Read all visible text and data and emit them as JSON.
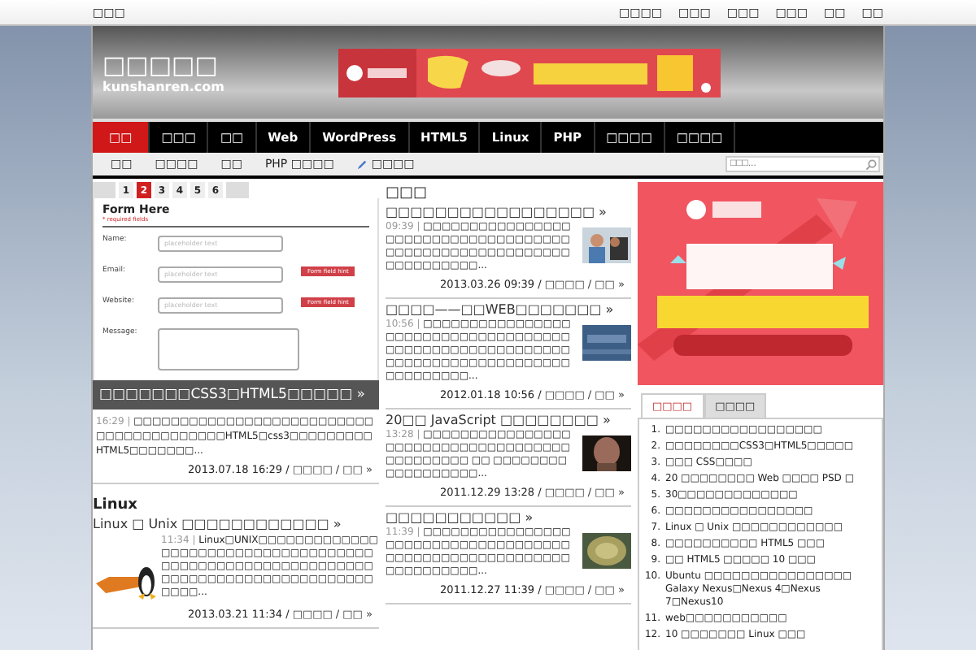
{
  "topbar": {
    "left": "□□□",
    "links": [
      "□□□□",
      "□□□",
      "□□□",
      "□□□",
      "□□",
      "□□"
    ]
  },
  "header": {
    "logo": "□□□□□",
    "domain": "kunshanren.com"
  },
  "nav": [
    {
      "label": "□□",
      "selected": true
    },
    {
      "label": "□□□",
      "selected": false
    },
    {
      "label": "□□",
      "selected": false
    },
    {
      "label": "Web",
      "selected": false
    },
    {
      "label": "WordPress",
      "selected": false
    },
    {
      "label": "HTML5",
      "selected": false
    },
    {
      "label": "Linux",
      "selected": false
    },
    {
      "label": "PHP",
      "selected": false
    },
    {
      "label": "□□□□",
      "selected": false
    },
    {
      "label": "□□□□",
      "selected": false
    }
  ],
  "subnav": [
    {
      "label": "□□",
      "kind": "text"
    },
    {
      "label": "□□□□",
      "kind": "text"
    },
    {
      "label": "□□",
      "kind": "text"
    },
    {
      "label": "PHP □□□□",
      "kind": "text"
    },
    {
      "label": "□□□□",
      "kind": "pen"
    }
  ],
  "search": {
    "placeholder": "□□□..."
  },
  "slider": {
    "pages": [
      {
        "label": "1",
        "selected": false
      },
      {
        "label": "2",
        "selected": true
      },
      {
        "label": "3",
        "selected": false
      },
      {
        "label": "4",
        "selected": false
      },
      {
        "label": "5",
        "selected": false
      },
      {
        "label": "6",
        "selected": false
      }
    ],
    "form": {
      "title": "Form Here",
      "note": "* required fields",
      "fields": [
        {
          "label": "Name:",
          "placeholder": "placeholder text",
          "kind": "input"
        },
        {
          "label": "Email:",
          "placeholder": "placeholder text",
          "kind": "input",
          "hint": "Form field hint"
        },
        {
          "label": "Website:",
          "placeholder": "placeholder text",
          "kind": "input",
          "hint": "Form field hint"
        },
        {
          "label": "Message:",
          "kind": "textarea"
        }
      ]
    },
    "caption": "□□□□□□□CSS3□HTML5□□□□□ »"
  },
  "featured": {
    "time": "16:29 |",
    "excerpt": "□□□□□□□□□□□□□□□□□□□□□□□□□□□□□□□□□□□□□□□□HTML5□css3□□□□□□□□□HTML5□□□□□□□...",
    "date": "2013.07.18 16:29 /",
    "category": "□□□□",
    "comments": "/ □□ »"
  },
  "linux": {
    "heading": "Linux",
    "title": "Linux □ Unix □□□□□□□□□□□□ »",
    "time": "11:34 |",
    "excerpt": "Linux□UNIX□□□□□□□□□□□□□□□□□□□□□□□□□□□□□□□□□□□□□□□□□□□□□□□□□□□□□□□□□□□□□□□□□□□□□□□□□□□□□□□□□□□□□□...",
    "date": "2013.03.21 11:34 /",
    "category": "□□□□",
    "comments": "/ □□ »"
  },
  "middle": {
    "heading": "□□□",
    "posts": [
      {
        "title": "□□□□□□□□□□□□□□□□□ »",
        "time": "09:39 |",
        "excerpt": "□□□□□□□□□□□□□□□□□□□□□□□□□□□□□□□□□□□□□□□□□□□□□□□□□□□□□□□□□□□□□□□□□□...",
        "date": "2013.03.26 09:39 /",
        "category": "□□□□",
        "comments": "/ □□ »"
      },
      {
        "title": "□□□□——□□WEB□□□□□□□ »",
        "time": "10:56 |",
        "excerpt": "□□□□□□□□□□□□□□□□□□□□□□□□□□□□□□□□□□□□□□□□□□□□□□□□□□□□□□□□□□□□□□□□□□□□□□□□□□□□□□□□□□□□□...",
        "date": "2012.01.18 10:56 /",
        "category": "□□□□",
        "comments": "/ □□ »"
      },
      {
        "title": "20□□ JavaScript □□□□□□□□ »",
        "time": "13:28 |",
        "excerpt": "□□□□□□□□□□□□□□□□□□□□□□□□□□□□□□□□□□□□□□□□□□□□□ □□ □□□□□□□□□□□□□□□□□□...",
        "date": "2011.12.29 13:28 /",
        "category": "□□□□",
        "comments": "/ □□ »"
      },
      {
        "title": "□□□□□□□□□□□ »",
        "time": "11:39 |",
        "excerpt": "□□□□□□□□□□□□□□□□□□□□□□□□□□□□□□□□□□□□□□□□□□□□□□□□□□□□□□□□□□□□□□□□□□...",
        "date": "2011.12.27 11:39 /",
        "category": "□□□□",
        "comments": "/ □□ »"
      }
    ]
  },
  "sidebar": {
    "tabs": [
      {
        "label": "□□□□",
        "selected": true
      },
      {
        "label": "□□□□",
        "selected": false
      }
    ],
    "list": [
      {
        "num": "1.",
        "text": "□□□□□□□□□□□□□□□□□"
      },
      {
        "num": "2.",
        "text": "□□□□□□□□CSS3□HTML5□□□□□"
      },
      {
        "num": "3.",
        "text": "□□□ CSS□□□□"
      },
      {
        "num": "4.",
        "text": "20 □□□□□□□□ Web □□□□ PSD □"
      },
      {
        "num": "5.",
        "text": "30□□□□□□□□□□□□□"
      },
      {
        "num": "6.",
        "text": "□□□□□□□□□□□□□□□□"
      },
      {
        "num": "7.",
        "text": "Linux □ Unix □□□□□□□□□□□□"
      },
      {
        "num": "8.",
        "text": "□□□□□□□□□□ HTML5 □□□"
      },
      {
        "num": "9.",
        "text": "□□ HTML5 □□□□□ 10 □□□"
      },
      {
        "num": "10.",
        "text": "Ubuntu □□□□□□□□□□□□□□□□ Galaxy Nexus□Nexus 4□Nexus 7□Nexus10"
      },
      {
        "num": "11.",
        "text": "web□□□□□□□□□□□"
      },
      {
        "num": "12.",
        "text": "10 □□□□□□□ Linux □□□"
      }
    ]
  }
}
